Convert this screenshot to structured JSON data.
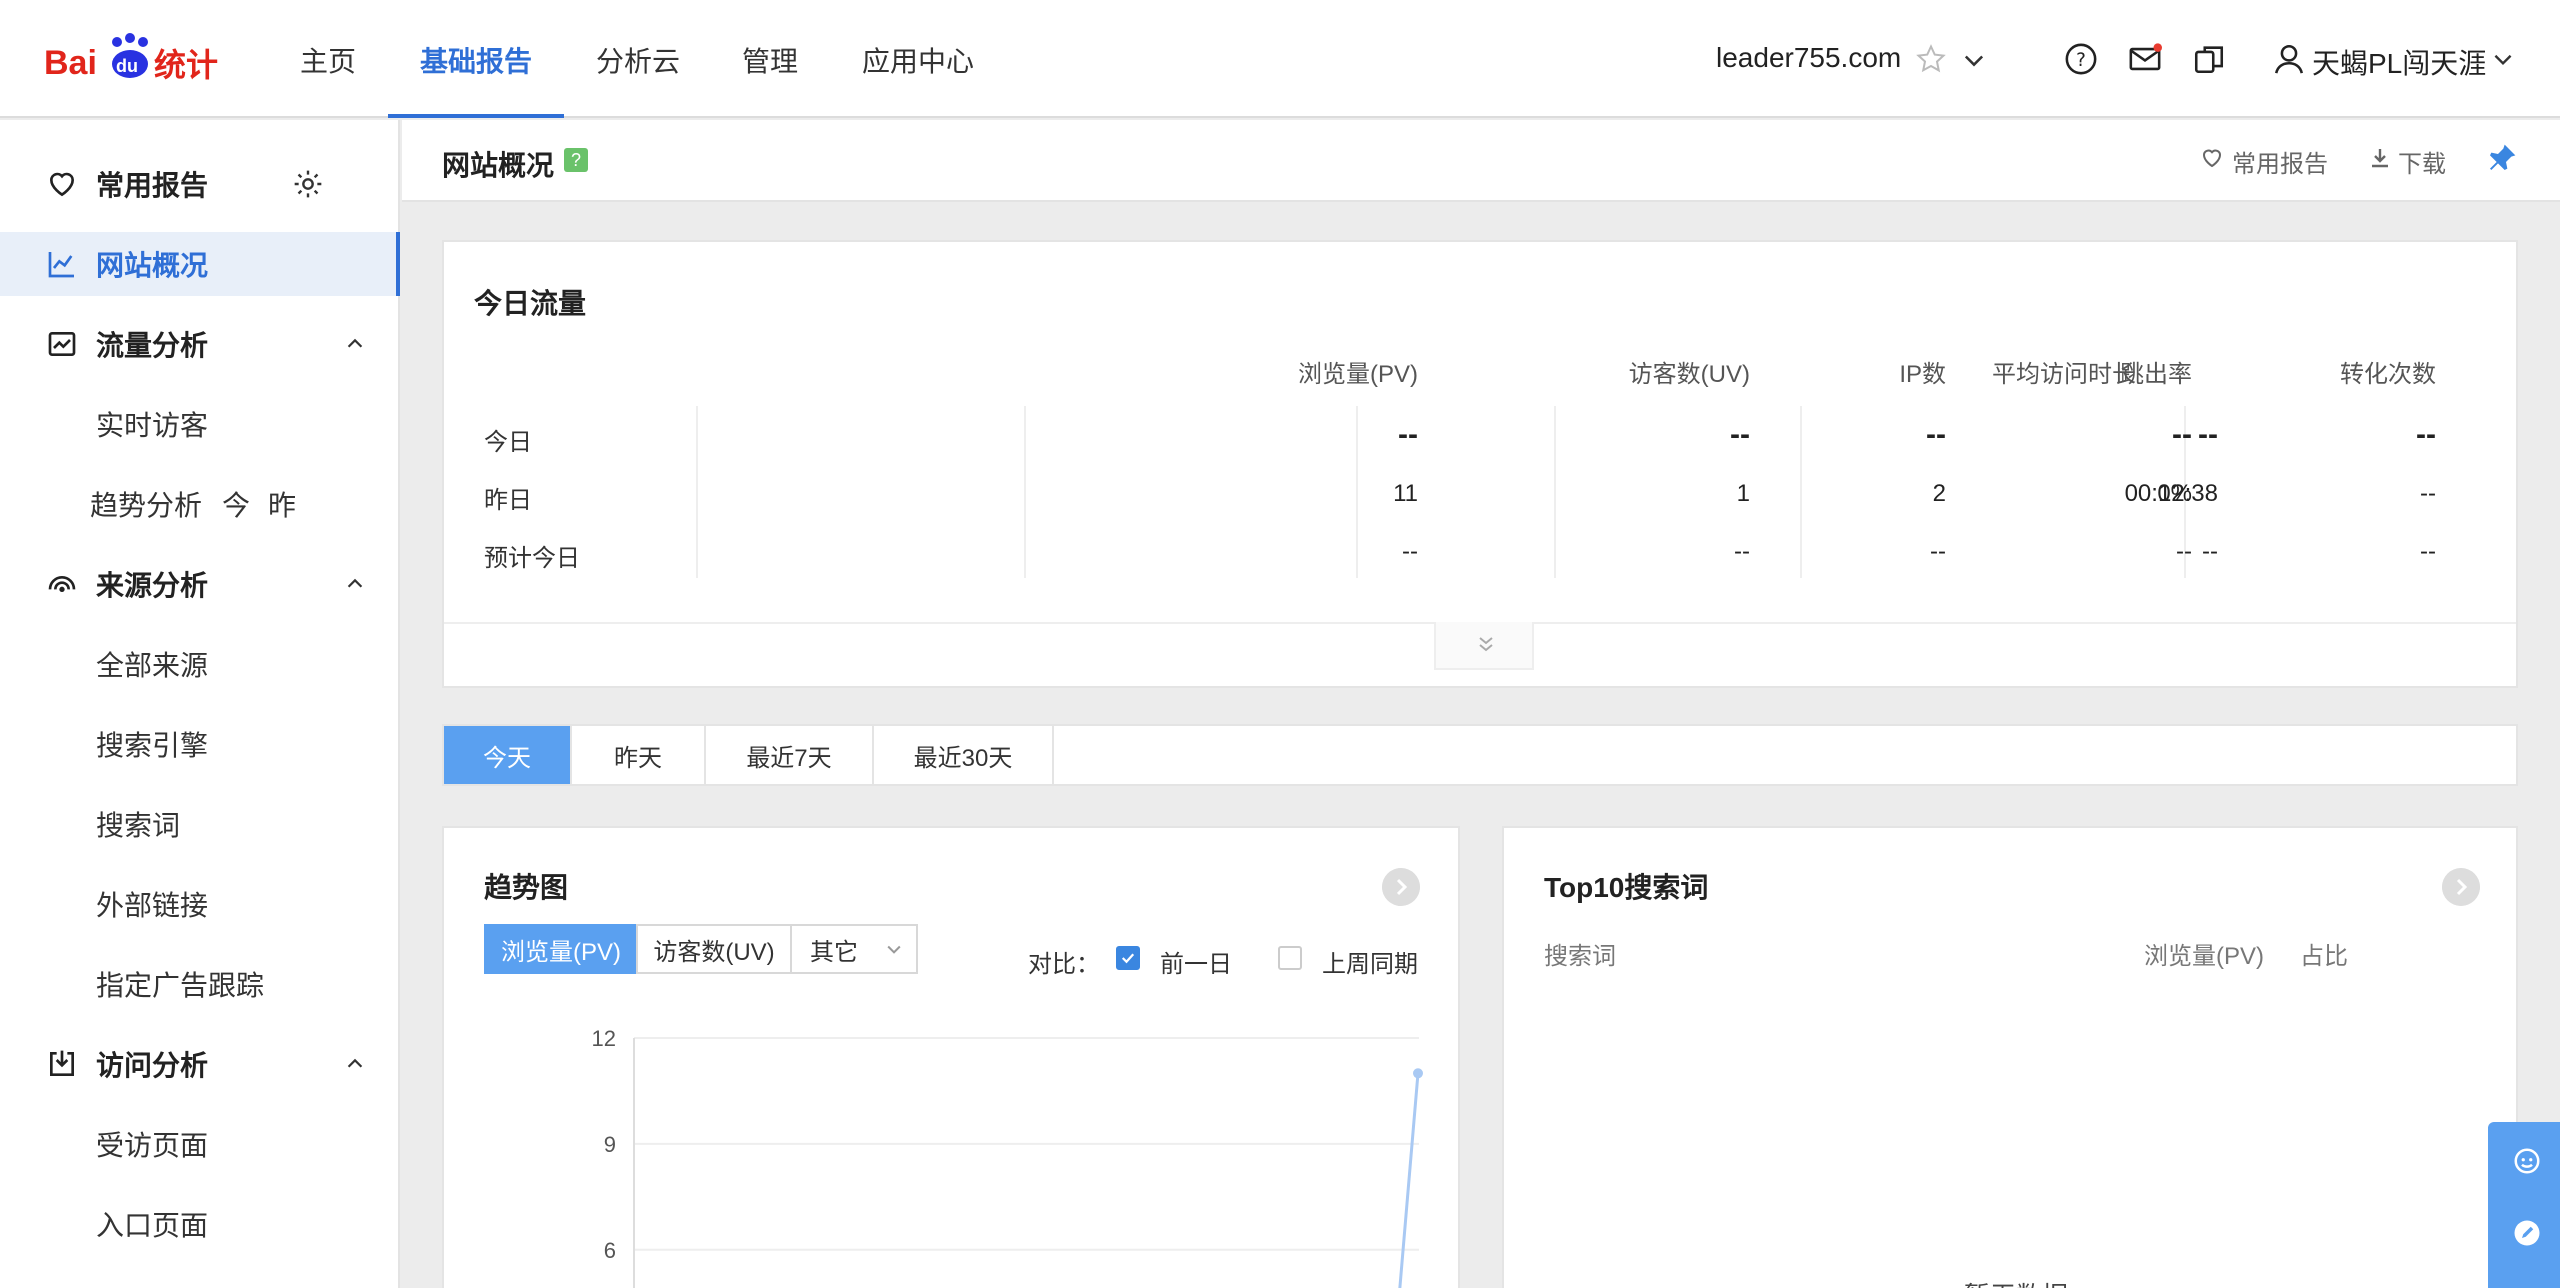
{
  "nav": {
    "items": [
      "主页",
      "基础报告",
      "分析云",
      "管理",
      "应用中心"
    ],
    "site": "leader755.com",
    "user": "天蝎PL闯天涯"
  },
  "sidebar": {
    "favorites": "常用报告",
    "overview": "网站概况",
    "traffic": {
      "label": "流量分析",
      "items": [
        "实时访客",
        "趋势分析"
      ],
      "today": "今",
      "yesterday": "昨"
    },
    "source": {
      "label": "来源分析",
      "items": [
        "全部来源",
        "搜索引擎",
        "搜索词",
        "外部链接",
        "指定广告跟踪"
      ]
    },
    "visit": {
      "label": "访问分析",
      "items": [
        "受访页面",
        "入口页面"
      ]
    }
  },
  "subhead": {
    "title": "网站概况",
    "help": "?",
    "fav": "常用报告",
    "download": "下载"
  },
  "today_traffic": {
    "title": "今日流量",
    "columns": [
      "浏览量(PV)",
      "访客数(UV)",
      "IP数",
      "跳出率",
      "平均访问时长",
      "转化次数"
    ],
    "rows": [
      {
        "label": "今日",
        "values": [
          "--",
          "--",
          "--",
          "--",
          "--",
          "--"
        ]
      },
      {
        "label": "昨日",
        "values": [
          "11",
          "1",
          "2",
          "0%",
          "00:12:38",
          "--"
        ]
      },
      {
        "label": "预计今日",
        "values": [
          "--",
          "--",
          "--",
          "--",
          "--",
          "--"
        ]
      }
    ]
  },
  "date_tabs": [
    "今天",
    "昨天",
    "最近7天",
    "最近30天"
  ],
  "trend": {
    "title": "趋势图",
    "metrics": [
      "浏览量(PV)",
      "访客数(UV)",
      "其它"
    ],
    "compare_label": "对比：",
    "prev_day": "前一日",
    "last_week": "上周同期"
  },
  "top10": {
    "title": "Top10搜索词",
    "col_word": "搜索词",
    "col_pv": "浏览量(PV)",
    "col_ratio": "占比",
    "empty": "暂无数据"
  },
  "chart_data": {
    "type": "line",
    "title": "",
    "xlabel": "",
    "ylabel": "",
    "ylim": [
      0,
      12
    ],
    "yticks": [
      "12",
      "9",
      "6"
    ],
    "series": [
      {
        "name": "浏览量(PV)",
        "values": [
          11
        ]
      }
    ]
  }
}
